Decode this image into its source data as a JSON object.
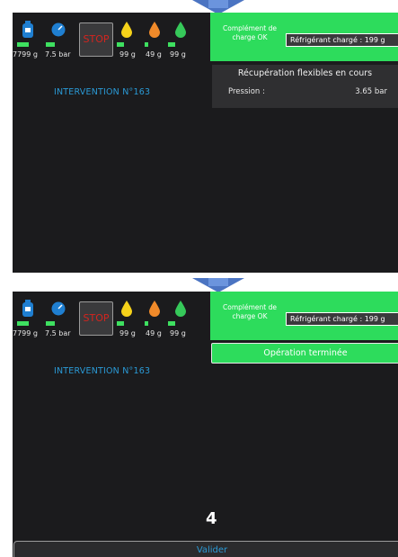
{
  "frames": [
    {
      "toolbar": {
        "tank_weight": "7799 g",
        "pressure": "7.5 bar",
        "stop_label": "STOP",
        "bottle_yellow": "99 g",
        "bottle_orange": "49 g",
        "bottle_green": "99 g"
      },
      "intervention_label": "INTERVENTION N°163",
      "charge_status": {
        "left_text": "Complément de charge OK",
        "right_text": "Réfrigérant chargé : 199 g"
      },
      "status_panel": {
        "title": "Récupération flexibles en cours",
        "pressure_label": "Pression :",
        "pressure_value": "3.65 bar"
      }
    },
    {
      "toolbar": {
        "tank_weight": "7799 g",
        "pressure": "7.5 bar",
        "stop_label": "STOP",
        "bottle_yellow": "99 g",
        "bottle_orange": "49 g",
        "bottle_green": "99 g"
      },
      "intervention_label": "INTERVENTION N°163",
      "charge_status": {
        "left_text": "Complément de charge OK",
        "right_text": "Réfrigérant chargé : 199 g"
      },
      "operation_button": "Opération terminée",
      "step_number": "4",
      "validate_button": "Valider"
    }
  ],
  "icons": {
    "tank": "tank-icon",
    "gauge": "gauge-icon",
    "yellow_drop": "yellow-drop-icon",
    "orange_drop": "orange-drop-icon",
    "green_drop": "green-drop-icon",
    "arrow": "down-arrow-icon"
  },
  "colors": {
    "background": "#1b1b1d",
    "accent_blue": "#2a9ad6",
    "status_green": "#2ddc5c",
    "stop_red": "#d4241e",
    "drop_yellow": "#f6d21a",
    "drop_orange": "#f08a2a",
    "drop_green": "#36c95a"
  }
}
